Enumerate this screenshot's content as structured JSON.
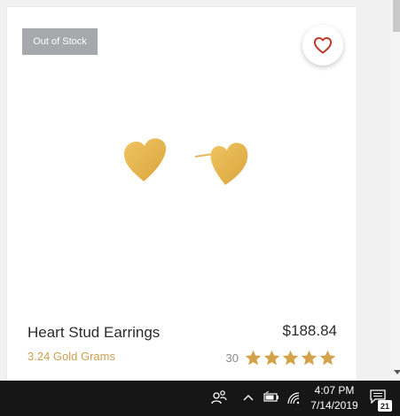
{
  "product": {
    "badge": "Out of Stock",
    "name": "Heart Stud Earrings",
    "price": "$188.84",
    "gold_weight": "3.24 Gold Grams",
    "review_count": "30",
    "rating": 5,
    "rating_max": 5,
    "image": "gold heart stud earrings"
  },
  "icons": {
    "favorite": "heart-outline-icon",
    "star": "star-icon",
    "people": "people-icon",
    "chevron_up": "chevron-up-icon",
    "battery": "battery-icon",
    "wifi": "wifi-icon",
    "notifications": "notification-icon"
  },
  "taskbar": {
    "time": "4:07 PM",
    "date": "7/14/2019",
    "notification_count": "21"
  },
  "colors": {
    "badge_bg": "#a7a8ab",
    "accent_gold": "#c9a14e",
    "star": "#d4a24a",
    "heart": "#c0392b",
    "taskbar_bg": "#161616"
  }
}
